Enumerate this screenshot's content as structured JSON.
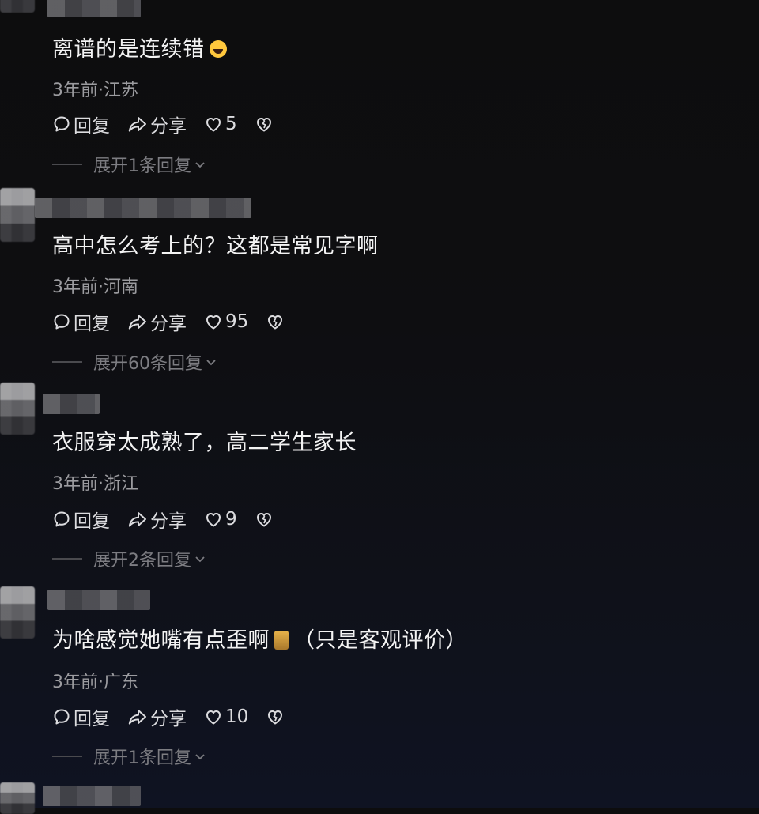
{
  "comments": [
    {
      "text": "离谱的是连续错",
      "emoji": "grinning-face-emoji",
      "meta": "3年前·江苏",
      "reply_label": "回复",
      "share_label": "分享",
      "likes": "5",
      "expand_label": "展开1条回复"
    },
    {
      "text": "高中怎么考上的？这都是常见字啊",
      "meta": "3年前·河南",
      "reply_label": "回复",
      "share_label": "分享",
      "likes": "95",
      "expand_label": "展开60条回复"
    },
    {
      "text": "衣服穿太成熟了，高二学生家长",
      "meta": "3年前·浙江",
      "reply_label": "回复",
      "share_label": "分享",
      "likes": "9",
      "expand_label": "展开2条回复"
    },
    {
      "text": "为啥感觉她嘴有点歪啊",
      "text_suffix": "（只是客观评价）",
      "emoji": "sticker-emoji",
      "meta": "3年前·广东",
      "reply_label": "回复",
      "share_label": "分享",
      "likes": "10",
      "expand_label": "展开1条回复"
    }
  ],
  "icons": {
    "reply": "reply-bubble-icon",
    "share": "share-arrow-icon",
    "like": "heart-icon",
    "dislike": "broken-heart-icon",
    "expand": "chevron-down-icon"
  },
  "colors": {
    "background": "#0e0e11",
    "text": "#f3f3f3",
    "meta": "#9c9ca0",
    "expand": "#7d7d82"
  }
}
